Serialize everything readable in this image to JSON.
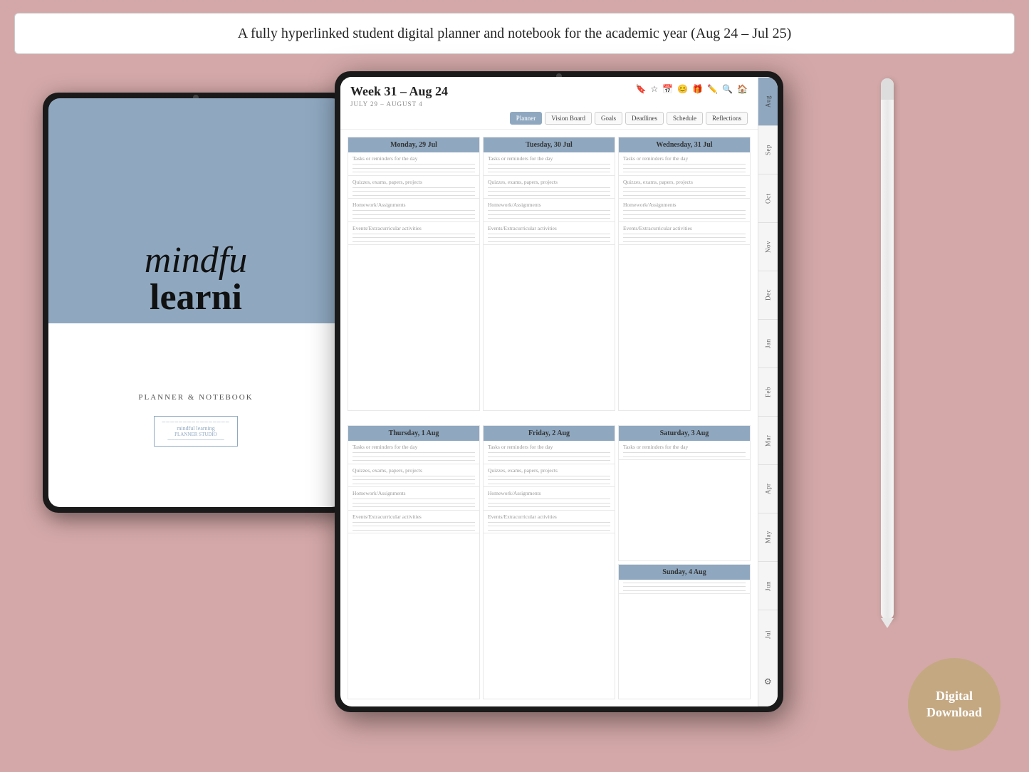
{
  "header": {
    "text": "A fully hyperlinked student digital planner and notebook for the academic year (Aug 24 – Jul 25)"
  },
  "left_tablet": {
    "cover_top_text": "mindfu",
    "cover_bottom_text": "learni",
    "subtitle": "PLANNER & NOTEBOOK",
    "logo_text": "mindful learning"
  },
  "planner": {
    "week_title": "Week 31 – Aug 24",
    "week_dates": "JULY 29 – AUGUST 4",
    "nav_tabs": [
      "Planner",
      "Vision Board",
      "Goals",
      "Deadlines",
      "Schedule",
      "Reflections"
    ],
    "days_top": [
      {
        "label": "Monday, 29 Jul"
      },
      {
        "label": "Tuesday, 30 Jul"
      },
      {
        "label": "Wednesday, 31 Jul"
      }
    ],
    "days_bottom": [
      {
        "label": "Thursday, 1 Aug"
      },
      {
        "label": "Friday, 2 Aug"
      },
      {
        "label": "Saturday, 3 Aug"
      }
    ],
    "sunday_label": "Sunday, 4 Aug",
    "section_labels": {
      "tasks": "Tasks or reminders for the day",
      "quizzes": "Quizzes, exams, papers, projects",
      "homework": "Homework/Assignments",
      "events": "Events/Extracurricular activities"
    }
  },
  "months": [
    "Aug",
    "Sep",
    "Oct",
    "Nov",
    "Dec",
    "Jan",
    "Feb",
    "Mar",
    "Apr",
    "May",
    "Jun",
    "Jul"
  ],
  "digital_download": {
    "line1": "Digital",
    "line2": "Download"
  }
}
